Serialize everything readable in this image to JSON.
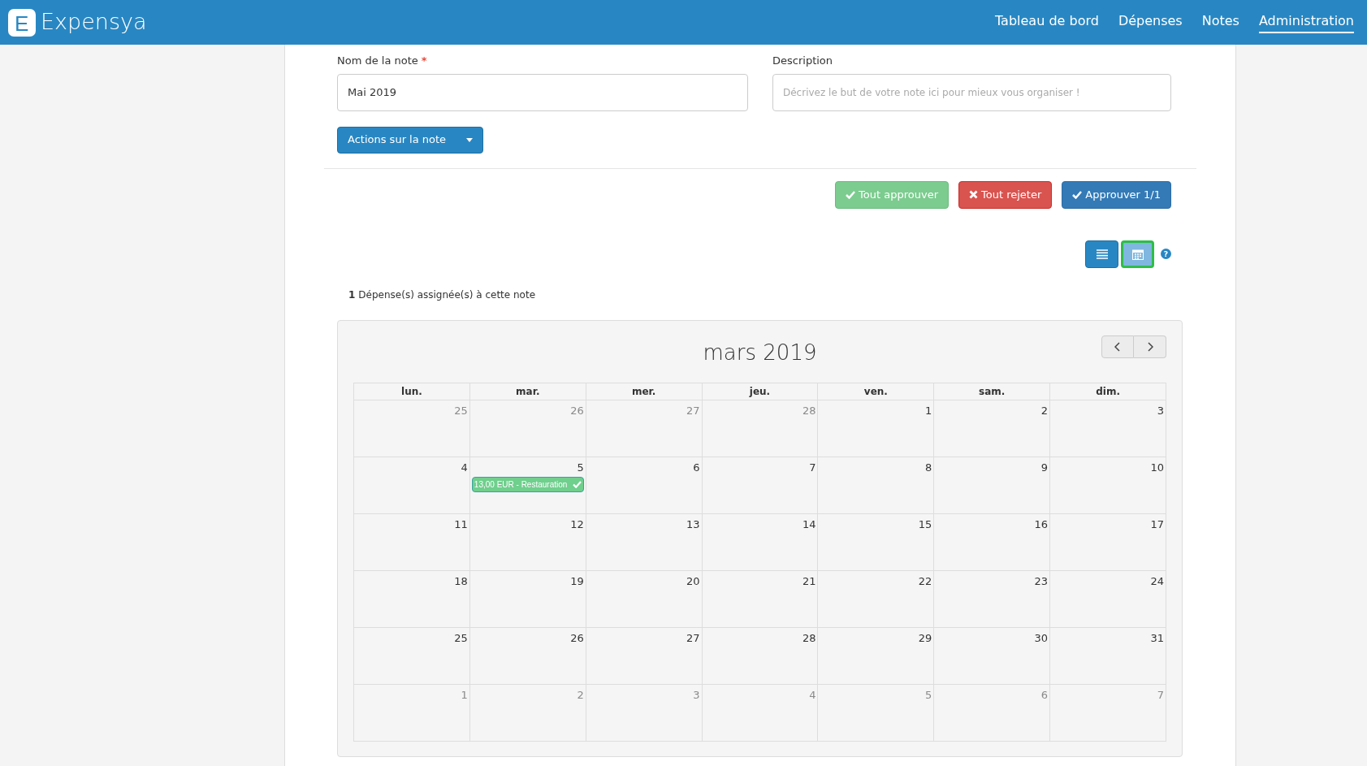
{
  "header": {
    "logo_letter": "E",
    "brand": "Expensya",
    "nav": [
      {
        "label": "Tableau de bord",
        "selected": false
      },
      {
        "label": "Dépenses",
        "selected": false
      },
      {
        "label": "Notes",
        "selected": false
      },
      {
        "label": "Administration",
        "selected": true
      }
    ]
  },
  "form": {
    "name_label": "Nom de la note",
    "required_mark": "*",
    "name_value": "Mai 2019",
    "description_label": "Description",
    "description_placeholder": "Décrivez le but de votre note ici pour mieux vous organiser !",
    "actions_button": "Actions sur la note"
  },
  "approval_buttons": [
    {
      "kind": "approve_all",
      "label": "Tout approuver"
    },
    {
      "kind": "reject_all",
      "label": "Tout rejeter"
    },
    {
      "kind": "approve",
      "label": "Approuver 1/1"
    }
  ],
  "view_toggle": [
    {
      "kind": "list",
      "selected": false
    },
    {
      "kind": "calendar",
      "selected": true
    }
  ],
  "help_icon": "?",
  "expense_count": {
    "count": "1",
    "text": "Dépense(s) assignée(s) à cette note"
  },
  "calendar": {
    "title": "mars 2019",
    "weekdays": [
      "lun.",
      "mar.",
      "mer.",
      "jeu.",
      "ven.",
      "sam.",
      "dim."
    ],
    "weeks": [
      [
        {
          "day": "25",
          "other_month": true
        },
        {
          "day": "26",
          "other_month": true
        },
        {
          "day": "27",
          "other_month": true
        },
        {
          "day": "28",
          "other_month": true
        },
        {
          "day": "1",
          "other_month": false
        },
        {
          "day": "2",
          "other_month": false
        },
        {
          "day": "3",
          "other_month": false
        }
      ],
      [
        {
          "day": "4",
          "other_month": false
        },
        {
          "day": "5",
          "other_month": false,
          "events": [
            {
              "label": "13,00 EUR - Restauration",
              "approved": true
            }
          ]
        },
        {
          "day": "6",
          "other_month": false
        },
        {
          "day": "7",
          "other_month": false
        },
        {
          "day": "8",
          "other_month": false
        },
        {
          "day": "9",
          "other_month": false
        },
        {
          "day": "10",
          "other_month": false
        }
      ],
      [
        {
          "day": "11",
          "other_month": false
        },
        {
          "day": "12",
          "other_month": false
        },
        {
          "day": "13",
          "other_month": false
        },
        {
          "day": "14",
          "other_month": false
        },
        {
          "day": "15",
          "other_month": false
        },
        {
          "day": "16",
          "other_month": false
        },
        {
          "day": "17",
          "other_month": false
        }
      ],
      [
        {
          "day": "18",
          "other_month": false
        },
        {
          "day": "19",
          "other_month": false
        },
        {
          "day": "20",
          "other_month": false
        },
        {
          "day": "21",
          "other_month": false
        },
        {
          "day": "22",
          "other_month": false
        },
        {
          "day": "23",
          "other_month": false
        },
        {
          "day": "24",
          "other_month": false
        }
      ],
      [
        {
          "day": "25",
          "other_month": false
        },
        {
          "day": "26",
          "other_month": false
        },
        {
          "day": "27",
          "other_month": false
        },
        {
          "day": "28",
          "other_month": false
        },
        {
          "day": "29",
          "other_month": false
        },
        {
          "day": "30",
          "other_month": false
        },
        {
          "day": "31",
          "other_month": false
        }
      ],
      [
        {
          "day": "1",
          "other_month": true
        },
        {
          "day": "2",
          "other_month": true
        },
        {
          "day": "3",
          "other_month": true
        },
        {
          "day": "4",
          "other_month": true
        },
        {
          "day": "5",
          "other_month": true
        },
        {
          "day": "6",
          "other_month": true
        },
        {
          "day": "7",
          "other_month": true
        }
      ]
    ]
  }
}
